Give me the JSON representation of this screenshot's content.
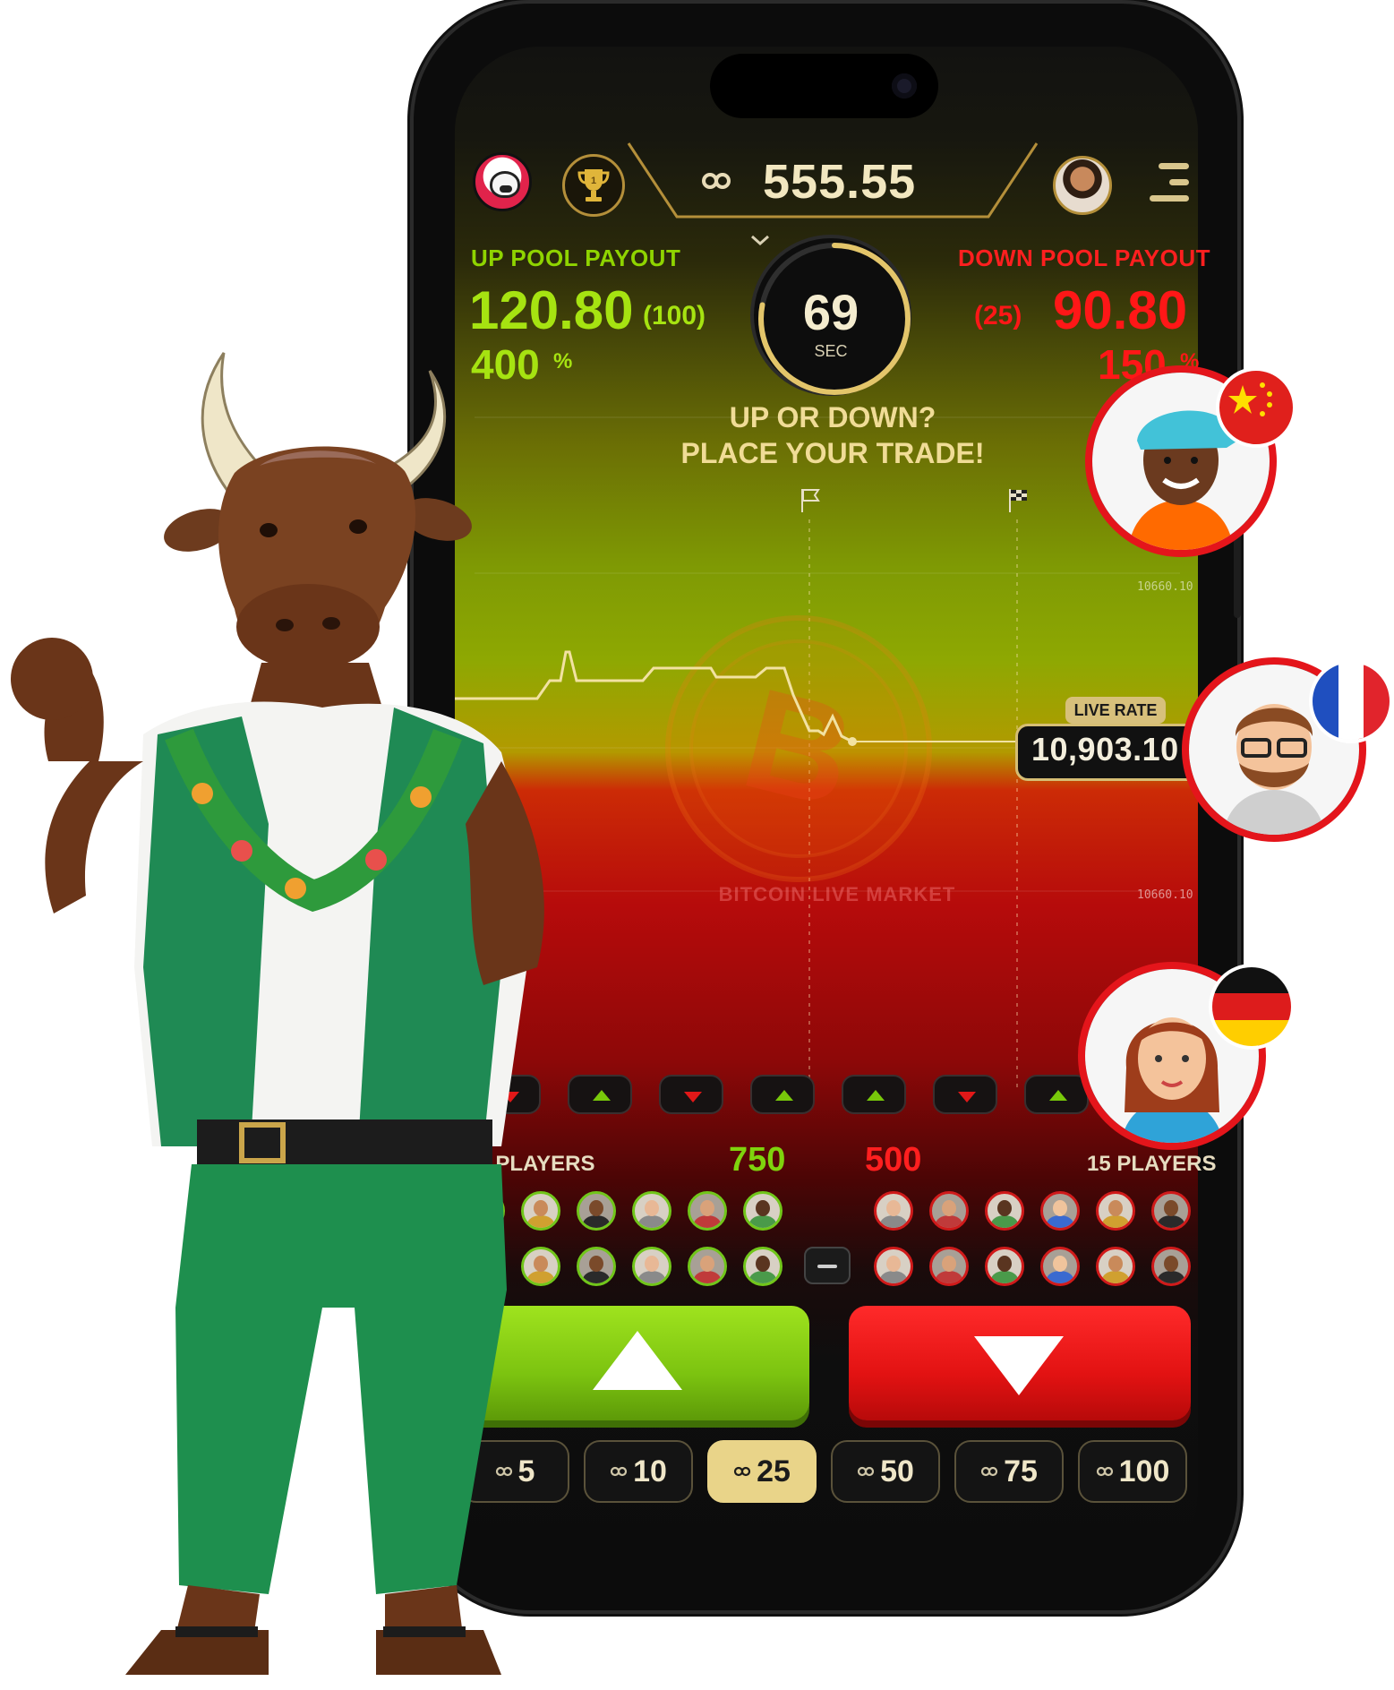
{
  "header": {
    "balance": "555.55"
  },
  "up_pool": {
    "label": "UP POOL PAYOUT",
    "payout": "120.80",
    "stake_count": "(100)",
    "percent": "400",
    "percent_sign": "%"
  },
  "down_pool": {
    "label": "DOWN POOL PAYOUT",
    "payout": "90.80",
    "stake_count": "(25)",
    "percent": "150",
    "percent_sign": "%"
  },
  "timer": {
    "seconds": "69",
    "unit": "SEC",
    "progress": 0.78
  },
  "prompt": {
    "line1": "UP OR DOWN?",
    "line2": "PLACE YOUR TRADE!"
  },
  "chart": {
    "tick_upper": "10660.10",
    "tick_lower": "10660.10",
    "watermark": "BITCOIN LIVE MARKET",
    "live_rate_label": "LIVE RATE",
    "live_rate_value": "10,903.10"
  },
  "trade_markers": [
    "down",
    "up",
    "down",
    "up",
    "up",
    "down",
    "up"
  ],
  "players": {
    "up_count_label": "22 PLAYERS",
    "up_total": "750",
    "down_total": "500",
    "down_count_label": "15 PLAYERS"
  },
  "amounts": [
    {
      "value": "5",
      "selected": false
    },
    {
      "value": "10",
      "selected": false
    },
    {
      "value": "25",
      "selected": true
    },
    {
      "value": "50",
      "selected": false
    },
    {
      "value": "75",
      "selected": false
    },
    {
      "value": "100",
      "selected": false
    }
  ],
  "colors": {
    "up": "#8fd400",
    "down": "#ff1f1f",
    "gold": "#d6be74"
  },
  "icons": [
    "bulldog-logo-icon",
    "trophy-icon",
    "link-coin-icon",
    "menu-icon",
    "bitcoin-icon",
    "flag-start-icon",
    "flag-finish-icon",
    "chevron-down-icon",
    "up-arrow-icon",
    "down-arrow-icon"
  ]
}
